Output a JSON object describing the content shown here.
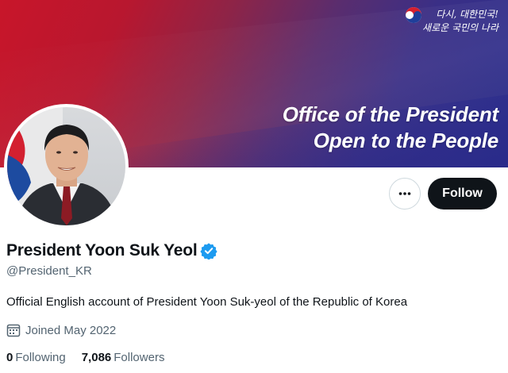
{
  "banner": {
    "slogan_line1": "Office of the President",
    "slogan_line2": "Open to the People",
    "brand_line1": "다시, 대한민국!",
    "brand_line2": "새로운 국민의 나라"
  },
  "profile": {
    "display_name": "President Yoon Suk Yeol",
    "handle": "@President_KR",
    "bio": "Official English account of President Yoon Suk-yeol of the Republic of Korea",
    "joined": "Joined May 2022",
    "verified": true
  },
  "actions": {
    "more_icon": "more-horizontal-icon",
    "follow_label": "Follow"
  },
  "stats": {
    "following_count": "0",
    "following_label": "Following",
    "followers_count": "7,086",
    "followers_label": "Followers"
  },
  "colors": {
    "banner_red": "#c8162a",
    "banner_blue": "#2b2f8e",
    "verified_blue": "#1d9bf0",
    "text_primary": "#0f1419",
    "text_secondary": "#536471",
    "follow_bg": "#0f1419"
  }
}
